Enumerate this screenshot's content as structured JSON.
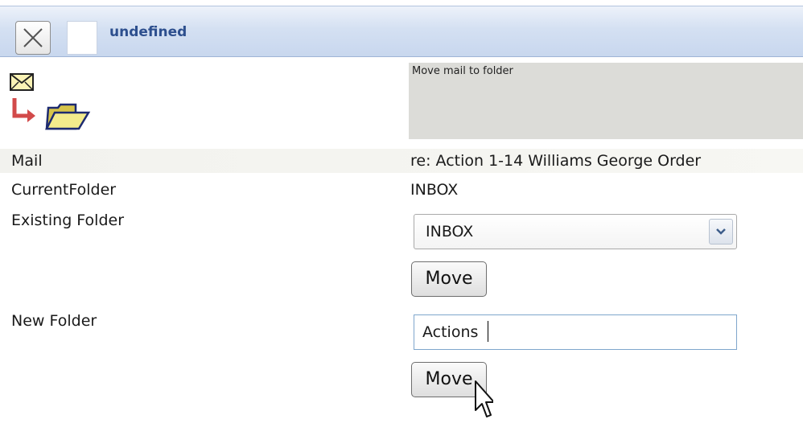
{
  "titlebar": {
    "title": "undefined",
    "close_icon": "close-x-icon"
  },
  "action": {
    "icon": "move-mail-to-folder-icon",
    "description": "Move mail to folder"
  },
  "form": {
    "mail_label": "Mail",
    "mail_value": "re: Action 1-14 Williams George Order",
    "current_folder_label": "CurrentFolder",
    "current_folder_value": "INBOX",
    "existing_folder_label": "Existing Folder",
    "existing_folder_selected": "INBOX",
    "move_button_1": "Move",
    "new_folder_label": "New Folder",
    "new_folder_value": "Actions",
    "move_button_2": "Move"
  },
  "colors": {
    "titlebar": "#c8d7ee",
    "title_text": "#2d4f8e",
    "description_bg": "#dcdcd8",
    "input_border": "#7fa6cc"
  }
}
